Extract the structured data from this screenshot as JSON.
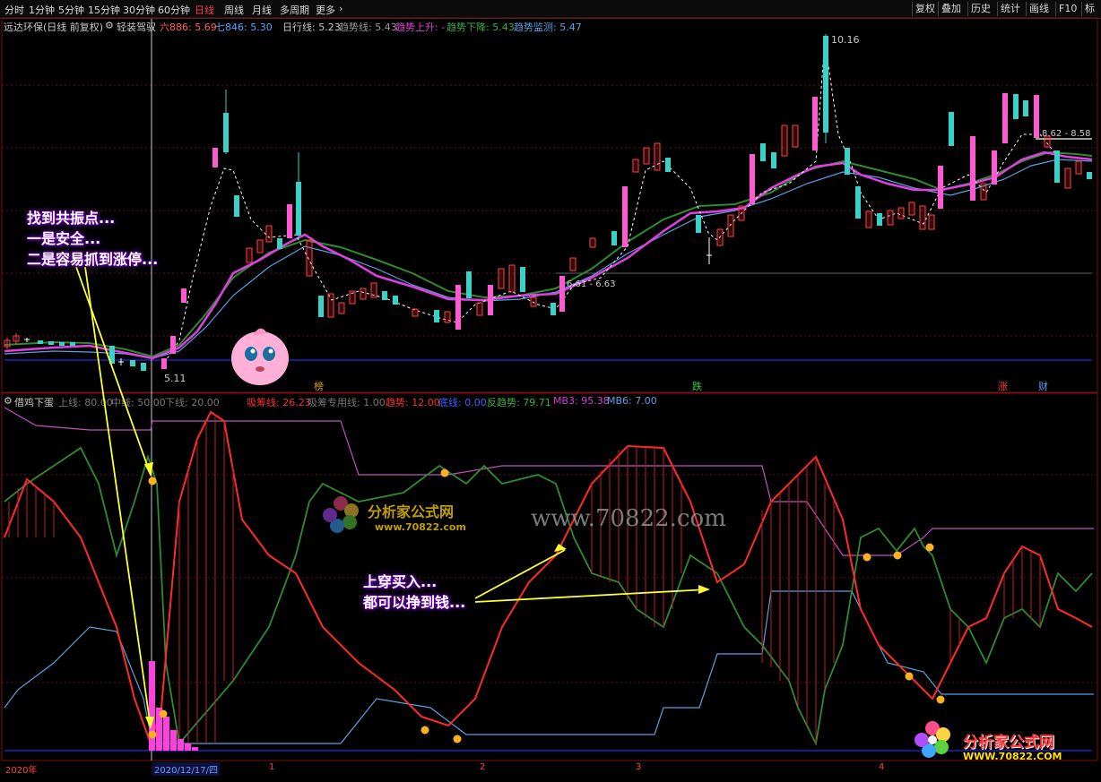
{
  "toolbar": {
    "items": [
      "分时",
      "1分钟",
      "5分钟",
      "15分钟",
      "30分钟",
      "60分钟",
      "日线",
      "周线",
      "月线",
      "多周期",
      "更多"
    ],
    "active": "日线",
    "right_items": [
      "复权",
      "叠加",
      "历史",
      "统计",
      "画线",
      "F10",
      "标"
    ]
  },
  "header": {
    "stock_name": "远达环保(日线 前复权)",
    "mode": "轻装驾驭",
    "ma_six_label": "六886: 5.69",
    "ma_seven_label": "七846: 5.30",
    "daily_line": "日行线: 5.23",
    "trend_line": "趋势线: 5.43",
    "trend_up": "趋势上升: -",
    "trend_down": "趋势下降: 5.43",
    "trend_monitor": "趋势监测: 5.47"
  },
  "indicator_header": {
    "name": "借鸡下蛋",
    "upper": "上线: 80.00",
    "middle": "中线: 50.00",
    "lower": "下线: 20.00",
    "absorb": "吸筹线: 26.23",
    "absorb_special": "吸筹专用线: 1.00",
    "trend": "趋势: 12.00",
    "bottom": "底线: 0.00",
    "reverse": "反趋势: 79.71",
    "mb3": "MB3: 95.38",
    "mb6": "MB6: 7.00"
  },
  "price_labels": {
    "high": "10.16",
    "low": "5.11",
    "range_mid": "6.61 - 6.63",
    "range_right": "8.62 - 8.58"
  },
  "markers": [
    "榜",
    "跌",
    "涨",
    "财"
  ],
  "callouts": {
    "resonance": [
      "找到共振点...",
      "一是安全...",
      "二是容易抓到涨停..."
    ],
    "cross": [
      "上穿买入...",
      "都可以挣到钱..."
    ]
  },
  "watermark": {
    "center_brand": "分析家公式网",
    "center_url": "www.70822.com",
    "center_domain": "www.70822.com",
    "logo_brand": "分析家公式网",
    "logo_url": "WWW.70822.COM"
  },
  "date_axis": {
    "year": "2020年",
    "cursor_date": "2020/12/17/四",
    "months": [
      "1",
      "2",
      "3",
      "4"
    ]
  },
  "colors": {
    "up_candle": "#ff5ad2",
    "down_candle": "#3bd1c8",
    "magenta_line": "#e040e0",
    "green_line": "#2e8b2e",
    "blue_line": "#5aa0e0",
    "red_line": "#ff2a2a",
    "callout_glow": "#7a00c8",
    "accent_active": "#ff4040"
  },
  "icons": [
    "chevron-right-icon",
    "settings-icon",
    "mascot-icon",
    "coin-icon",
    "flower-logo-icon"
  ]
}
